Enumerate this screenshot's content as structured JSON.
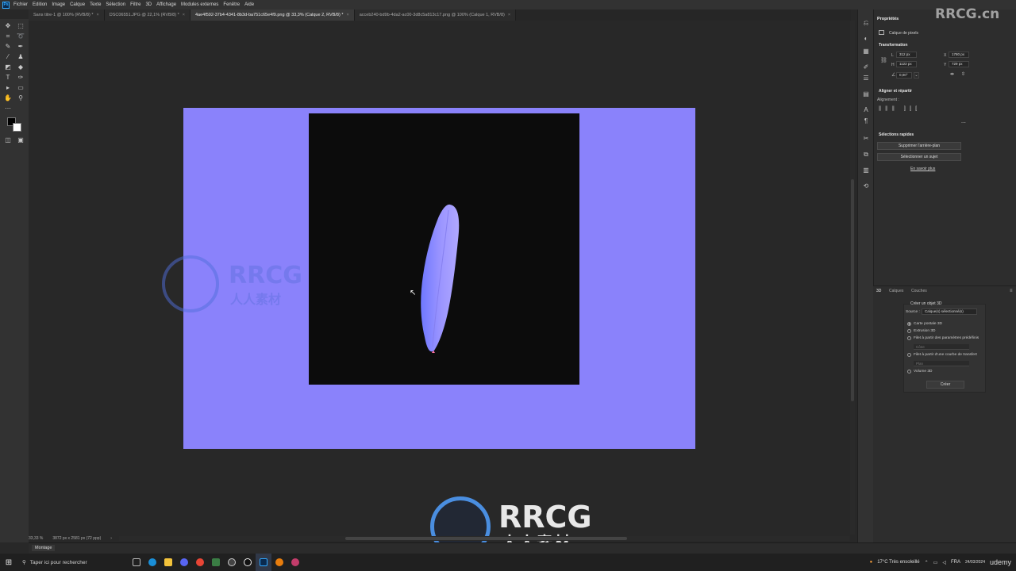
{
  "menubar": {
    "app_logo": "Ps",
    "items": [
      "Fichier",
      "Edition",
      "Image",
      "Calque",
      "Texte",
      "Sélection",
      "Filtre",
      "3D",
      "Affichage",
      "Modules externes",
      "Fenêtre",
      "Aide"
    ]
  },
  "tabs": [
    {
      "label": "Sans titre-1 @ 100% (RVB/8) *",
      "active": false
    },
    {
      "label": "DSC06551.JPG @ 22,1% (RVB/8) *",
      "active": false
    },
    {
      "label": "4ae4f592-37b4-4341-8b3d-ba751c65e4f9.png @ 33,3% (Calque 2, RVB/8) *",
      "active": true
    },
    {
      "label": "acceb240-bd9b-4da2-ac00-3d8c5a813c17.png @ 100% (Calque 1, RVB/8)",
      "active": false
    }
  ],
  "tab_close_glyph": "×",
  "watermark_top": "RRCG.cn",
  "status": {
    "zoom": "33,33 %",
    "doc_size": "3872 px x 2581 px (72 ppp)",
    "arrow": "›"
  },
  "bottom_panel_tab": "Montage",
  "properties": {
    "title": "Propriétés",
    "layer_type": "Calque de pixels",
    "transform_title": "Transformation",
    "w_label": "L",
    "w_value": "312 px",
    "h_label": "H",
    "h_value": "1122 px",
    "x_label": "X",
    "x_value": "1780 px",
    "y_label": "Y",
    "y_value": "729 px",
    "angle_value": "0,00°",
    "align_title": "Aligner et répartir",
    "align_label": "Alignement :",
    "more": "...",
    "quick_title": "Sélections rapides",
    "remove_bg": "Supprimer l'arrière-plan",
    "select_subject": "Sélectionner un sujet",
    "learn_more": "En savoir plus"
  },
  "panel3d": {
    "tabs": [
      "3D",
      "Calques",
      "Couches"
    ],
    "create_title": "Créer un objet 3D",
    "source_label": "Source :",
    "source_value": "Calque(s) sélectionné(s)",
    "options": [
      {
        "label": "Carte postale 3D",
        "selected": true
      },
      {
        "label": "Extrusion 3D",
        "selected": false
      },
      {
        "label": "Filet à partir des paramètres prédéfinis",
        "selected": false
      },
      {
        "label": "Filet à partir d'une courbe de transfert",
        "selected": false
      },
      {
        "label": "Volume 3D",
        "selected": false
      }
    ],
    "sub1": "Cône",
    "sub2": "Plan",
    "create_button": "Créer"
  },
  "taskbar": {
    "search_placeholder": "Taper ici pour rechercher",
    "weather": "17°C  Très ensoleillé",
    "lang": "FRA",
    "date": "24/03/2024",
    "udemy": "udemy"
  },
  "watermark": {
    "brand": "RRCG",
    "chinese": "人人素材"
  },
  "colors": {
    "canvas_bg": "#8a82fb",
    "layer_bg": "#0c0c0c",
    "ps_blue": "#31a8ff"
  }
}
